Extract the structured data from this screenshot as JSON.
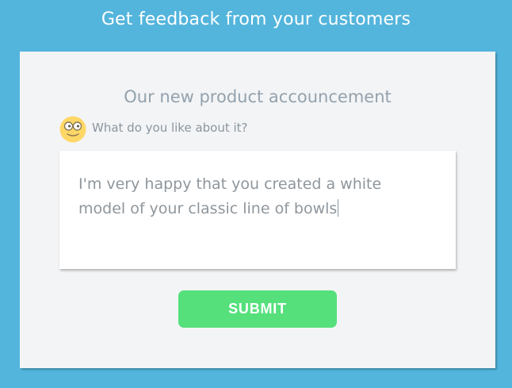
{
  "header": {
    "title": "Get feedback from your customers"
  },
  "card": {
    "title": "Our new product accouncement",
    "question": "What do you like about it?",
    "question_icon": "smiley-face-icon",
    "feedback_value": "I'm very happy that you created a white model of your classic line of bowls",
    "submit_label": "SUBMIT"
  },
  "colors": {
    "background": "#53b5dc",
    "card": "#f3f4f6",
    "submit": "#55e07c",
    "smiley": "#ffd766"
  }
}
